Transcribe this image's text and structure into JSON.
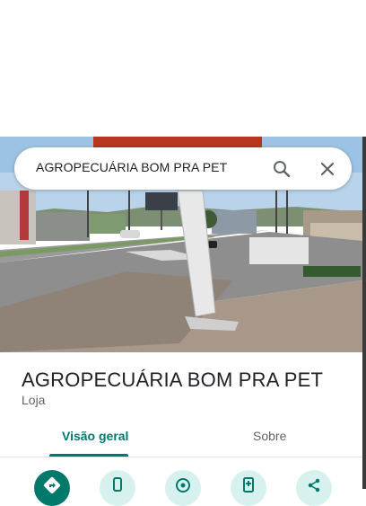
{
  "search": {
    "query": "AGROPECUÁRIA BOM PRA PET"
  },
  "place": {
    "name": "AGROPECUÁRIA BOM PRA PET",
    "category": "Loja"
  },
  "tabs": [
    {
      "label": "Visão geral",
      "active": true
    },
    {
      "label": "Sobre",
      "active": false
    }
  ],
  "actions": [
    {
      "icon": "directions-icon"
    },
    {
      "icon": "phone-icon"
    },
    {
      "icon": "location-icon"
    },
    {
      "icon": "save-icon"
    },
    {
      "icon": "share-icon"
    }
  ],
  "colors": {
    "accent": "#00796b",
    "action_bg": "#d6f1ee"
  }
}
